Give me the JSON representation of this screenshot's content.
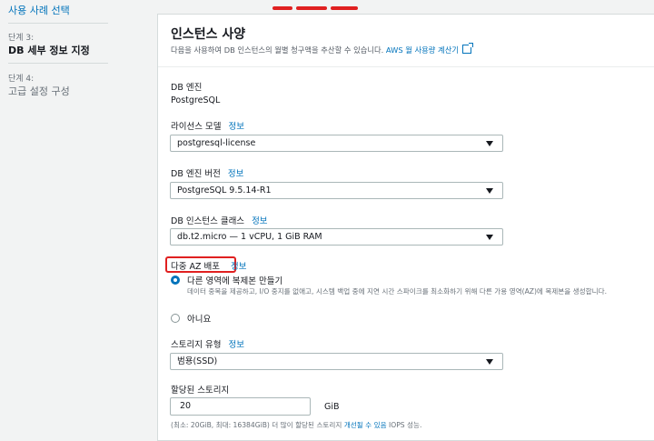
{
  "sidebar": {
    "prev_link": "사용 사례 선택",
    "steps": [
      {
        "step": "단계 3:",
        "title": "DB 세부 정보 지정"
      },
      {
        "step": "단계 4:",
        "title": "고급 설정 구성"
      }
    ]
  },
  "panel": {
    "title": "인스턴스 사양",
    "desc_prefix": "다음을 사용하여 DB 인스턴스의 월별 청구액을 추산할 수 있습니다. ",
    "desc_link": "AWS 월 사용량 계산기",
    "info_label": "정보",
    "engine": {
      "label": "DB 엔진",
      "value": "PostgreSQL"
    },
    "license": {
      "label": "라이선스 모델",
      "value": "postgresql-license"
    },
    "version": {
      "label": "DB 엔진 버전",
      "value": "PostgreSQL 9.5.14-R1"
    },
    "instance_class": {
      "label": "DB 인스턴스 클래스",
      "value": "db.t2.micro — 1 vCPU, 1 GiB RAM"
    },
    "multi_az": {
      "label": "다중 AZ 배포",
      "options": [
        {
          "label": "다른 영역에 복제본 만들기",
          "desc": "데이터 중복을 제공하고, I/O 중지를 없애고, 시스템 백업 중에 지연 시간 스파이크를 최소화하기 위해 다른 가용 영역(AZ)에 복제본을 생성합니다.",
          "selected": true
        },
        {
          "label": "아니요",
          "selected": false
        }
      ]
    },
    "storage_type": {
      "label": "스토리지 유형",
      "value": "범용(SSD)"
    },
    "allocated_storage": {
      "label": "할당된 스토리지",
      "value": "20",
      "unit": "GiB",
      "hint_prefix": "(최소: 20GiB, 최대: 16384GiB) 더 많이 할당된 스토리지 ",
      "hint_link": "개선될 수 있음",
      "hint_suffix": " IOPS 성능."
    }
  },
  "colors": {
    "accent": "#0073bb",
    "highlight": "#e02020"
  }
}
